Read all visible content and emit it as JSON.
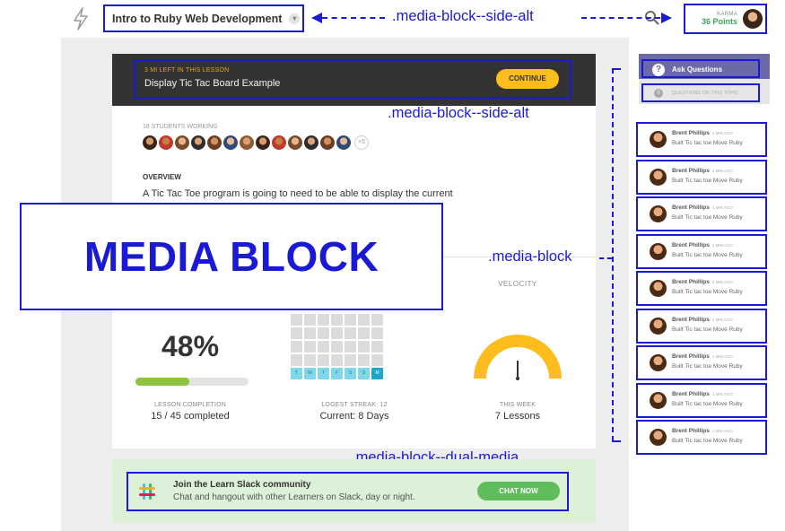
{
  "header": {
    "course_title": "Intro to Ruby Web Development",
    "karma_label": "KARMA",
    "karma_points": "36 Points"
  },
  "annotations": {
    "side_alt_top": ".media-block--side-alt",
    "side_alt_mid": ".media-block--side-alt",
    "media_block": ".media-block",
    "dual_media": ".media-block--dual-media",
    "big_label": "MEDIA BLOCK"
  },
  "lesson": {
    "time_left": "3 MI LEFT IN THIS LESSON",
    "title": "Display Tic Tac Board Example",
    "continue_label": "CONTINUE",
    "students_working": "18 STUDENTS WORKING",
    "more_students": "+5",
    "overview_label": "OVERVIEW",
    "overview_text": "A Tic Tac Toe program is going to need to be able to display the current",
    "overview_link": "e"
  },
  "stats": {
    "velocity_label": "VELOCITY",
    "completion_pct": "48%",
    "completion_fraction": 0.48,
    "completion_label": "LESSON COMPLETION",
    "completion_value": "15 / 45 completed",
    "streak_label": "LOGEST STREAK: 12",
    "streak_value": "Current: 8 Days",
    "week_days": [
      "T",
      "W",
      "T",
      "F",
      "S",
      "S",
      "M"
    ],
    "velocity_period": "THIS WEEK",
    "velocity_value": "7 Lessons"
  },
  "slack": {
    "title": "Join the Learn Slack community",
    "subtitle": "Chat and hangout with other Learners on Slack, day or night.",
    "button": "CHAT NOW"
  },
  "sidebar": {
    "ask_label": "Ask Questions",
    "questions_label": "QUESTIONS ON THIS TOPIC",
    "activity": [
      {
        "name": "Brent Phillips",
        "time": "1 MIN AGO",
        "text": "Built Tic tac toe  Move Ruby"
      },
      {
        "name": "Brent Phillips",
        "time": "1 MIN AGO",
        "text": "Built Tic tac toe  Move Ruby"
      },
      {
        "name": "Brent Phillips",
        "time": "1 MIN AGO",
        "text": "Built Tic tac toe  Move Ruby"
      },
      {
        "name": "Brent Phillips",
        "time": "1 MIN AGO",
        "text": "Built Tic tac toe  Move Ruby"
      },
      {
        "name": "Brent Phillips",
        "time": "1 MIN AGO",
        "text": "Built Tic tac toe  Move Ruby"
      },
      {
        "name": "Brent Phillips",
        "time": "1 MIN AGO",
        "text": "Built Tic tac toe  Move Ruby"
      },
      {
        "name": "Brent Phillips",
        "time": "1 MIN AGO",
        "text": "Built Tic tac toe  Move Ruby"
      },
      {
        "name": "Brent Phillips",
        "time": "1 MIN AGO",
        "text": "Built Tic tac toe  Move Ruby"
      },
      {
        "name": "Brent Phillips",
        "time": "1 MIN AGO",
        "text": "Built Tic tac toe  Move Ruby"
      }
    ]
  },
  "colors": {
    "annotation": "#1a1ad6",
    "accent_yellow": "#fdbd1c",
    "progress_green": "#8cc43f",
    "slack_green": "#5fbd5c",
    "sidebar_purple": "#6b6aa6"
  }
}
